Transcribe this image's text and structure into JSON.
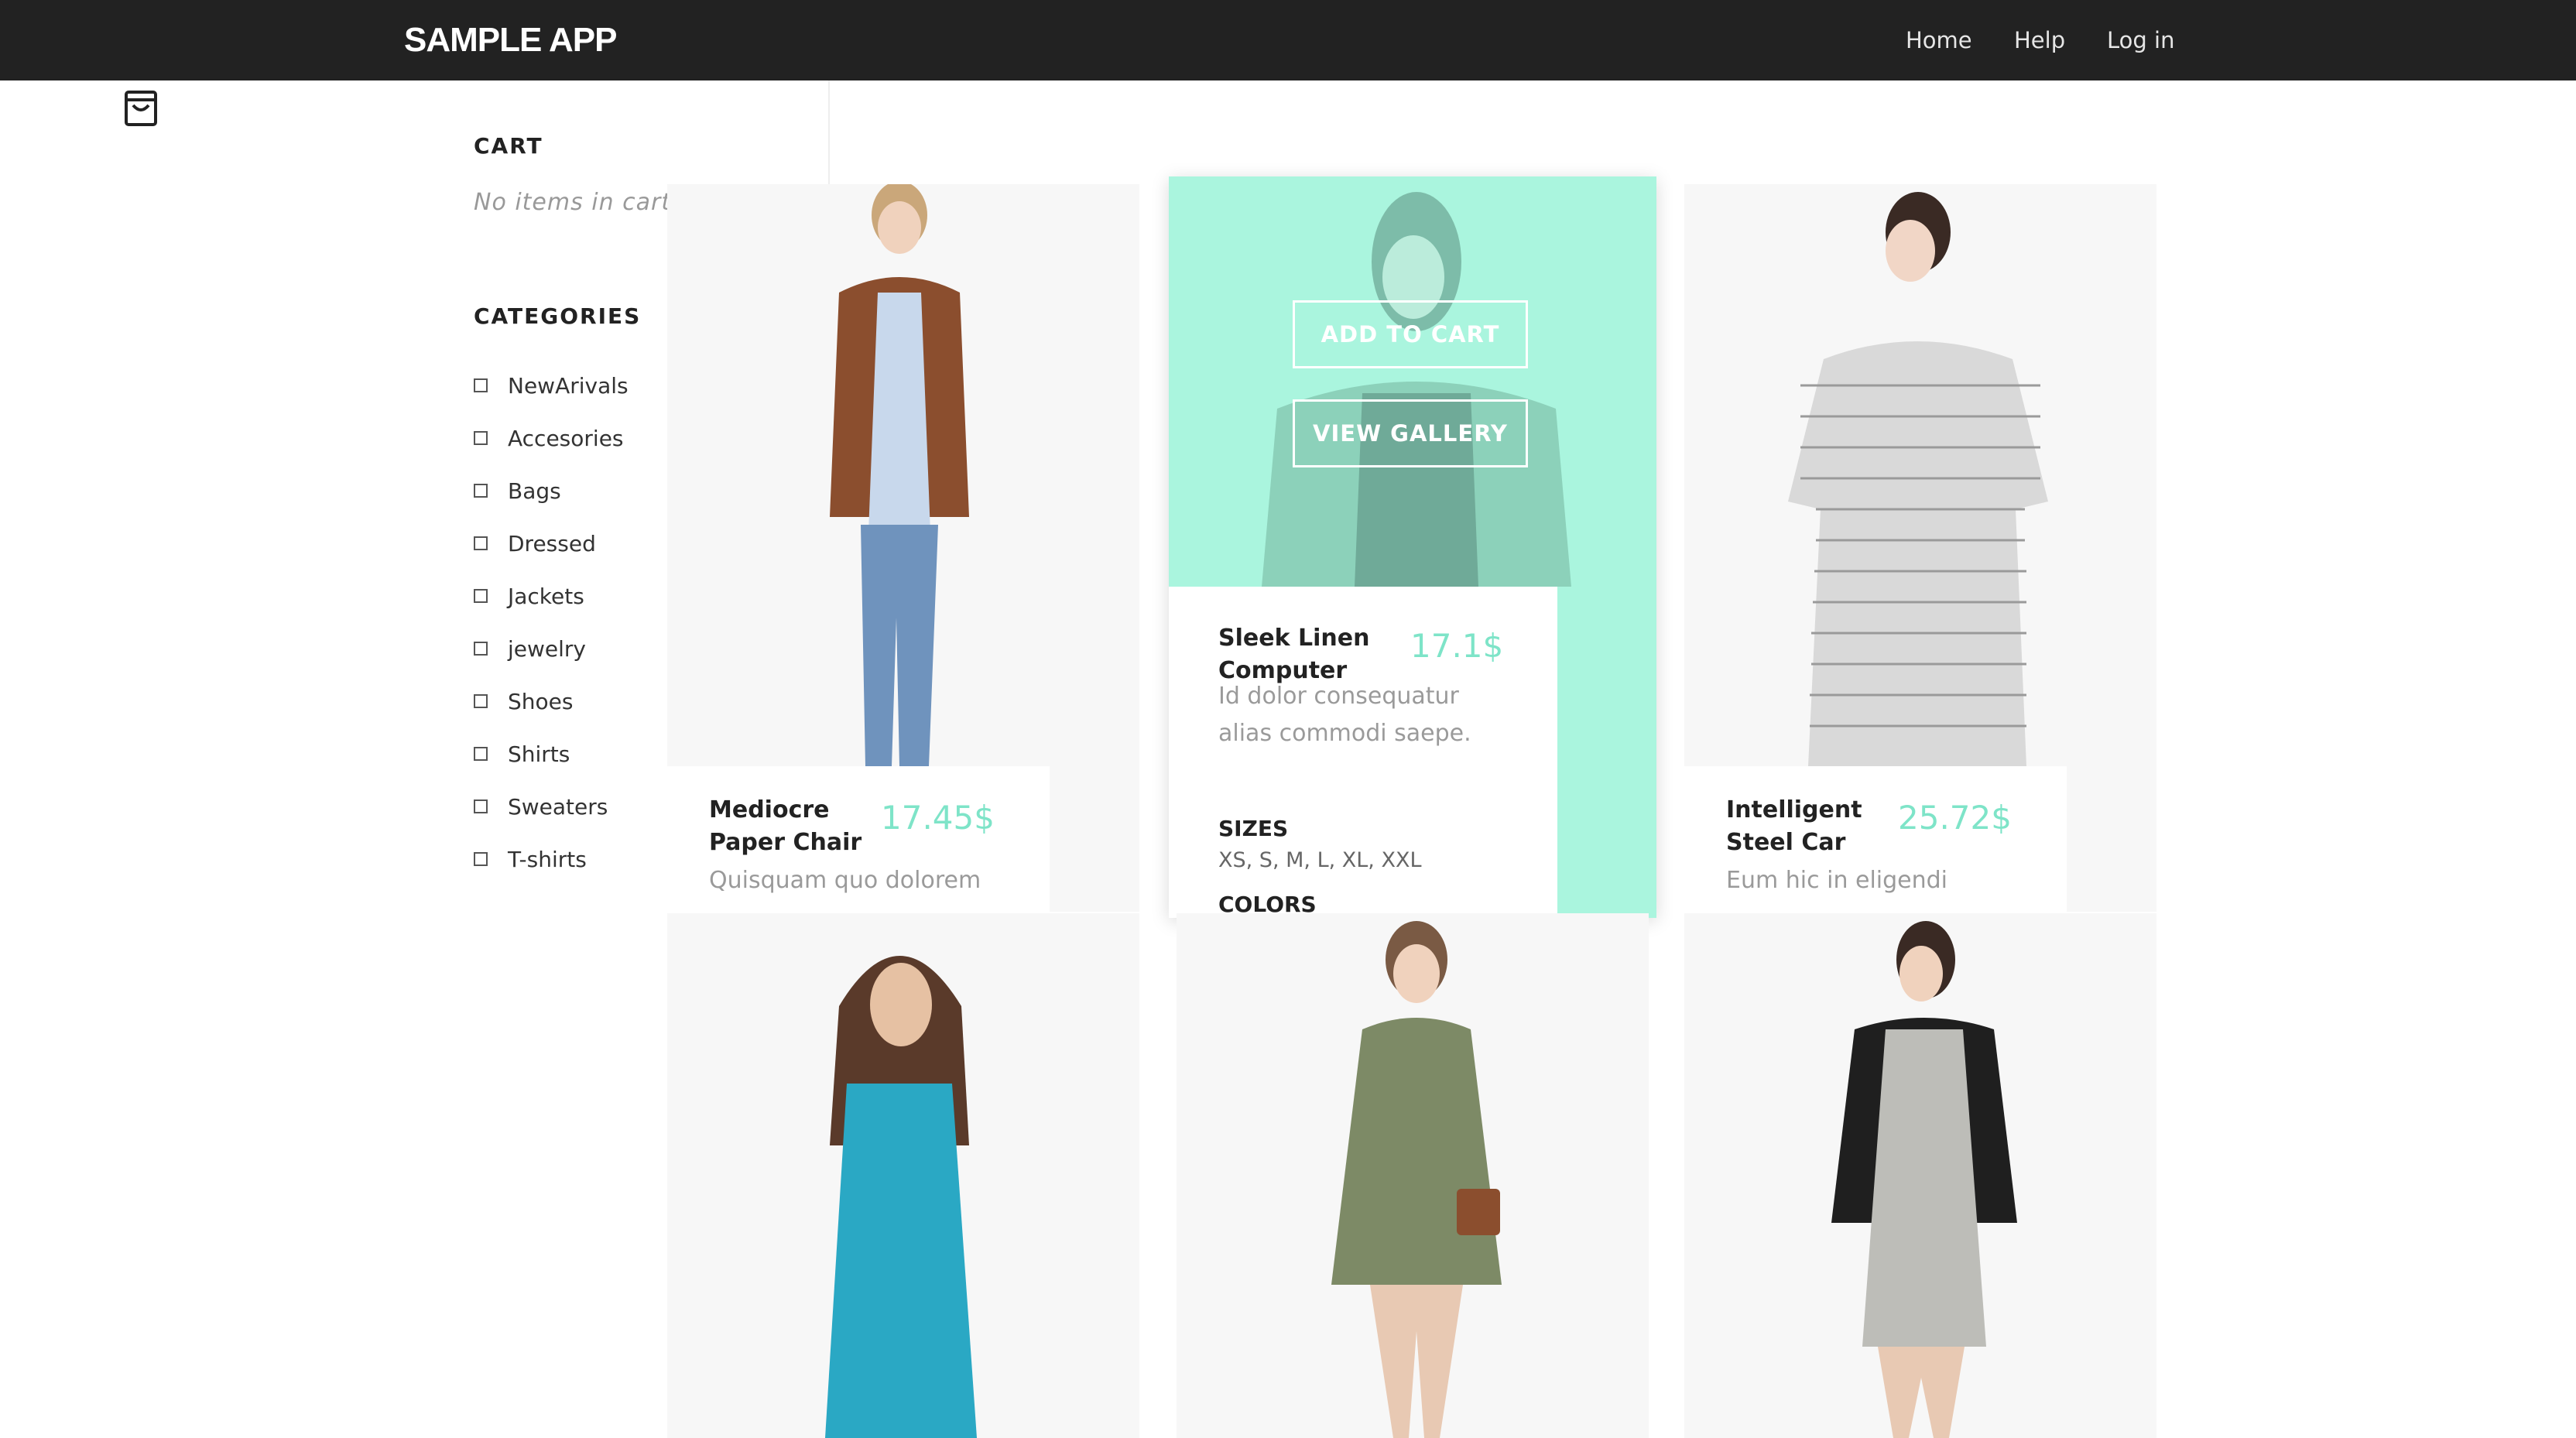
{
  "header": {
    "brand": "SAMPLE APP",
    "nav": [
      "Home",
      "Help",
      "Log in"
    ]
  },
  "cart": {
    "title": "CART",
    "empty_text": "No items in cart."
  },
  "categories": {
    "title": "CATEGORIES",
    "items": [
      "NewArivals",
      "Accesories",
      "Bags",
      "Dressed",
      "Jackets",
      "jewelry",
      "Shoes",
      "Shirts",
      "Sweaters",
      "T-shirts"
    ]
  },
  "products": [
    {
      "name": "Mediocre Paper Chair",
      "price": "17.45$",
      "description": "Quisquam quo dolorem"
    },
    {
      "name": "Sleek Linen Computer",
      "price": "17.1$",
      "description": "Id dolor consequatur alias commodi saepe.",
      "sizes_title": "SIZES",
      "sizes": "XS, S, M, L, XL, XXL",
      "colors_title": "COLORS",
      "add_to_cart": "ADD TO CART",
      "view_gallery": "VIEW GALLERY"
    },
    {
      "name": "Intelligent Steel Car",
      "price": "25.72$",
      "description": "Eum hic in eligendi"
    }
  ],
  "colors": {
    "topbar": "#222222",
    "accent": "#7ee4c8",
    "hover_overlay": "#aaf5de",
    "card_bg": "#f7f7f7"
  },
  "icons": {
    "cart": "shopping-bag-icon"
  }
}
